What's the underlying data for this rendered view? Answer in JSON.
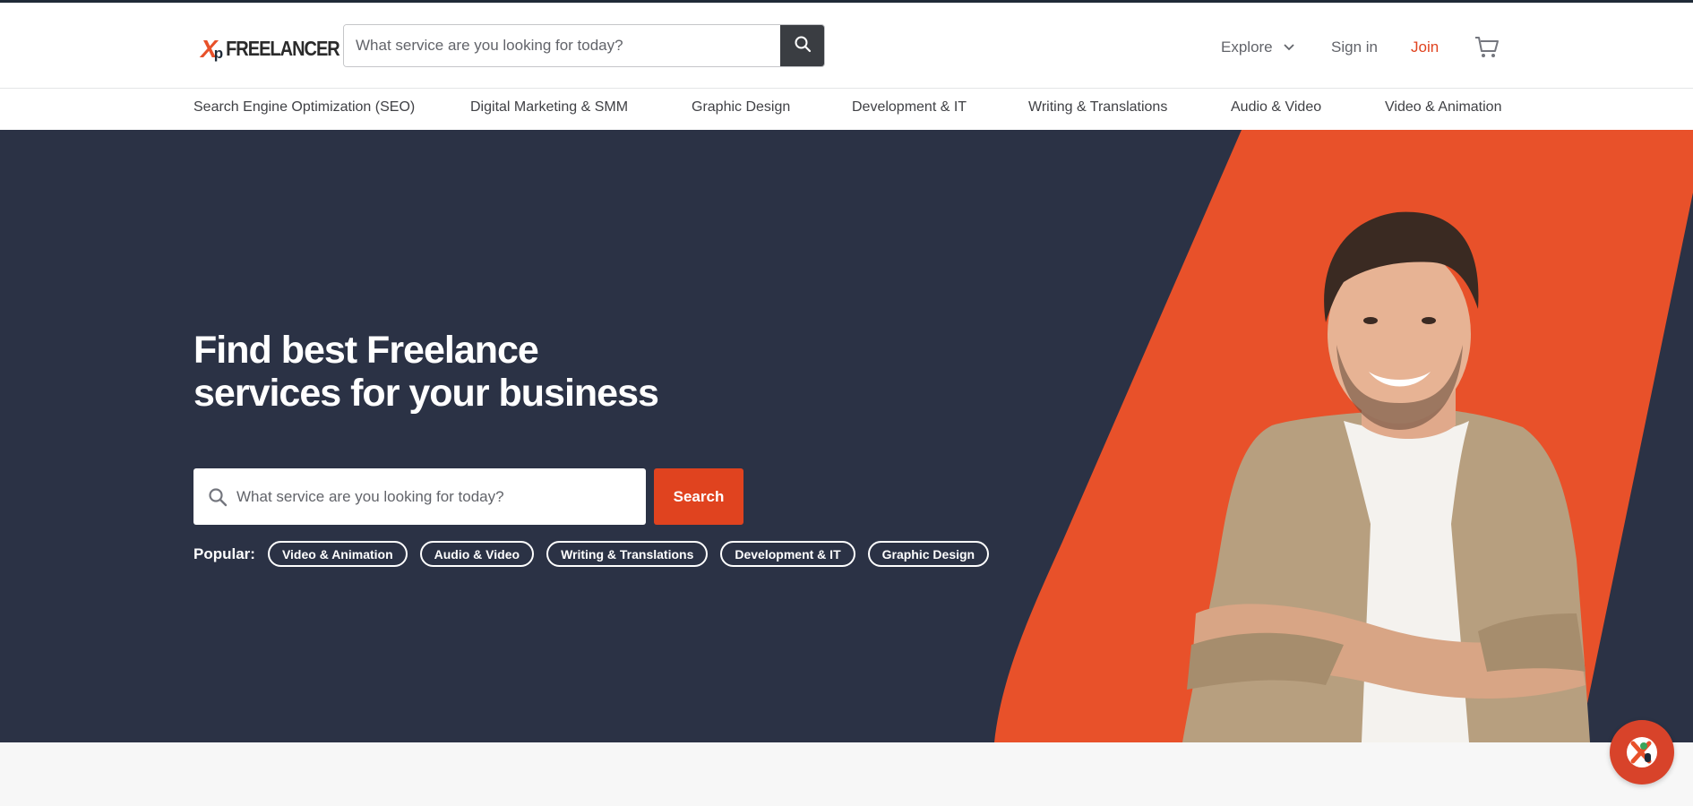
{
  "header": {
    "logo_mark": "X",
    "logo_sub": "p",
    "logo_text": "FREELANCER",
    "search_placeholder": "What service are you looking for today?",
    "search_icon": "search-icon",
    "explore_label": "Explore",
    "signin_label": "Sign in",
    "join_label": "Join",
    "cart_icon": "cart-icon"
  },
  "categories": [
    "Search Engine Optimization (SEO)",
    "Digital Marketing & SMM",
    "Graphic Design",
    "Development & IT",
    "Writing & Translations",
    "Audio & Video",
    "Video & Animation"
  ],
  "hero": {
    "title_line1": "Find best Freelance",
    "title_line2": "services for your business",
    "search_placeholder": "What service are you looking for today?",
    "search_button": "Search",
    "popular_label": "Popular:",
    "popular_tags": [
      "Video & Animation",
      "Audio & Video",
      "Writing & Translations",
      "Development & IT",
      "Graphic Design"
    ]
  },
  "colors": {
    "accent": "#e0431f",
    "hero_bg": "#2b3245",
    "stripe": "#e8512a"
  },
  "chat_icon": "chat-logo-icon"
}
